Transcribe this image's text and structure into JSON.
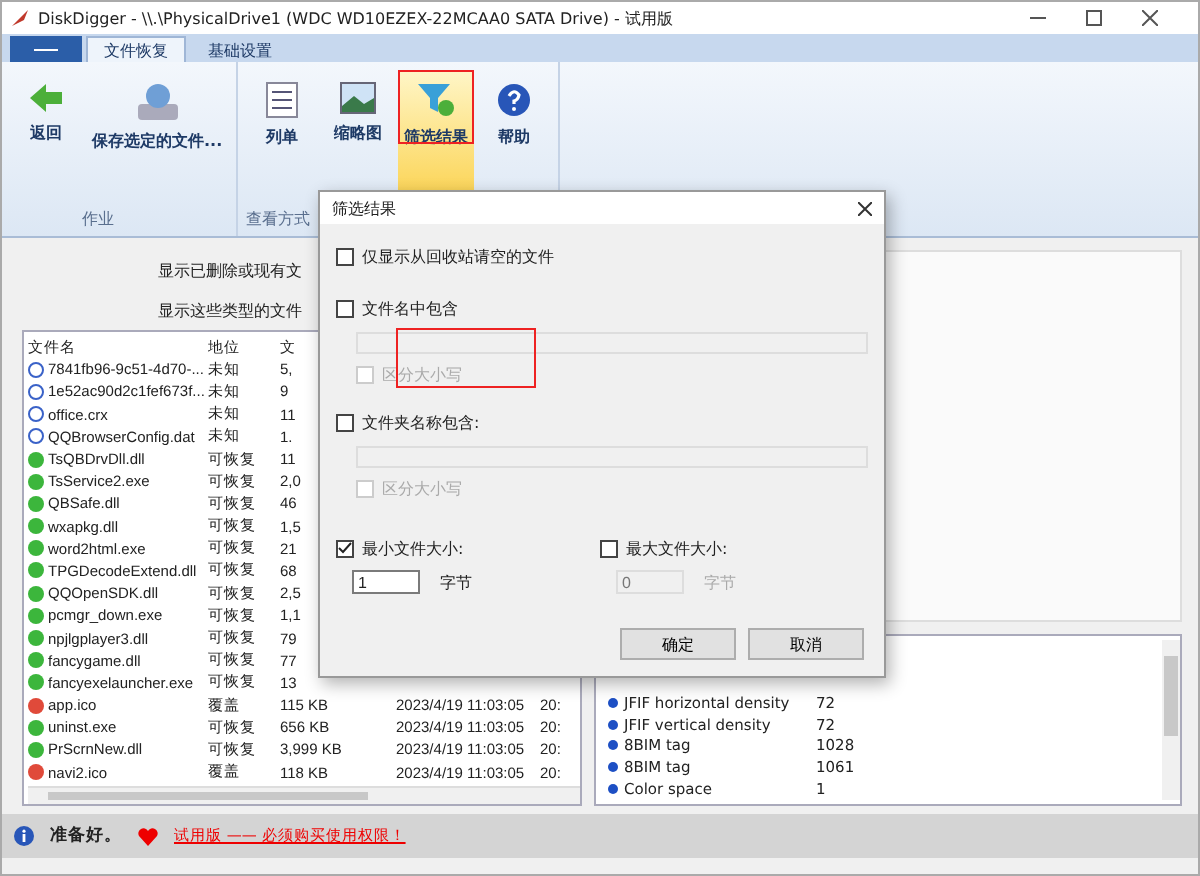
{
  "window": {
    "title": "DiskDigger - \\\\.\\PhysicalDrive1 (WDC WD10EZEX-22MCAA0 SATA Drive) - 试用版"
  },
  "ribbon": {
    "tabs": [
      {
        "label": "文件恢复",
        "selected": true
      },
      {
        "label": "基础设置",
        "selected": false
      }
    ],
    "groups": [
      {
        "label": "作业",
        "buttons": [
          {
            "label": "返回",
            "kind": "back",
            "selected": false
          },
          {
            "label": "保存选定的文件...",
            "kind": "save",
            "selected": false
          }
        ]
      },
      {
        "label": "查看方式",
        "buttons": [
          {
            "label": "列单",
            "kind": "list",
            "selected": false
          },
          {
            "label": "缩略图",
            "kind": "thumbs",
            "selected": false
          },
          {
            "label": "筛选结果",
            "kind": "filter",
            "selected": true
          },
          {
            "label": "帮助",
            "kind": "help",
            "selected": false
          }
        ]
      }
    ]
  },
  "filters": {
    "labels": [
      "显示已删除或现有文",
      "显示这些类型的文件"
    ]
  },
  "file_list": {
    "columns": [
      "文件名",
      "地位",
      "文"
    ],
    "rows": [
      {
        "name": "7841fb96-9c51-4d70-...",
        "status": "未知",
        "kind": "unknown",
        "size": "5,",
        "date": "",
        "col5": ""
      },
      {
        "name": "1e52ac90d2c1fef673f...",
        "status": "未知",
        "kind": "unknown",
        "size": "9",
        "date": "",
        "col5": ""
      },
      {
        "name": "office.crx",
        "status": "未知",
        "kind": "unknown",
        "size": "11",
        "date": "",
        "col5": ""
      },
      {
        "name": "QQBrowserConfig.dat",
        "status": "未知",
        "kind": "unknown",
        "size": "1.",
        "date": "",
        "col5": ""
      },
      {
        "name": "TsQBDrvDll.dll",
        "status": "可恢复",
        "kind": "good",
        "size": "11",
        "date": "",
        "col5": ""
      },
      {
        "name": "TsService2.exe",
        "status": "可恢复",
        "kind": "good",
        "size": "2,0",
        "date": "",
        "col5": ""
      },
      {
        "name": "QBSafe.dll",
        "status": "可恢复",
        "kind": "good",
        "size": "46",
        "date": "",
        "col5": ""
      },
      {
        "name": "wxapkg.dll",
        "status": "可恢复",
        "kind": "good",
        "size": "1,5",
        "date": "",
        "col5": ""
      },
      {
        "name": "word2html.exe",
        "status": "可恢复",
        "kind": "good",
        "size": "21",
        "date": "",
        "col5": ""
      },
      {
        "name": "TPGDecodeExtend.dll",
        "status": "可恢复",
        "kind": "good",
        "size": "68",
        "date": "",
        "col5": ""
      },
      {
        "name": "QQOpenSDK.dll",
        "status": "可恢复",
        "kind": "good",
        "size": "2,5",
        "date": "",
        "col5": ""
      },
      {
        "name": "pcmgr_down.exe",
        "status": "可恢复",
        "kind": "good",
        "size": "1,1",
        "date": "",
        "col5": ""
      },
      {
        "name": "npjlgplayer3.dll",
        "status": "可恢复",
        "kind": "good",
        "size": "79",
        "date": "",
        "col5": ""
      },
      {
        "name": "fancygame.dll",
        "status": "可恢复",
        "kind": "good",
        "size": "77",
        "date": "",
        "col5": ""
      },
      {
        "name": "fancyexelauncher.exe",
        "status": "可恢复",
        "kind": "good",
        "size": "13",
        "date": "",
        "col5": ""
      },
      {
        "name": "app.ico",
        "status": "覆盖",
        "kind": "bad",
        "size": "115 KB",
        "date": "2023/4/19 11:03:05",
        "col5": "20:"
      },
      {
        "name": "uninst.exe",
        "status": "可恢复",
        "kind": "good",
        "size": "656 KB",
        "date": "2023/4/19 11:03:05",
        "col5": "20:"
      },
      {
        "name": "PrScrnNew.dll",
        "status": "可恢复",
        "kind": "good",
        "size": "3,999 KB",
        "date": "2023/4/19 11:03:05",
        "col5": "20:"
      },
      {
        "name": "navi2.ico",
        "status": "覆盖",
        "kind": "bad",
        "size": "118 KB",
        "date": "2023/4/19 11:03:05",
        "col5": "20:"
      }
    ]
  },
  "properties": [
    {
      "name": "JFIF horizontal density",
      "value": "72"
    },
    {
      "name": "JFIF vertical density",
      "value": "72"
    },
    {
      "name": "8BIM tag",
      "value": "1028"
    },
    {
      "name": "8BIM tag",
      "value": "1061"
    },
    {
      "name": "Color space",
      "value": "1"
    }
  ],
  "status_bar": {
    "text": "准备好。",
    "link": "试用版 —— 必须购买使用权限！"
  },
  "dialog": {
    "title": "筛选结果",
    "recycle": {
      "label": "仅显示从回收站请空的文件",
      "checked": false
    },
    "name_filter": {
      "label": "文件名中包含",
      "checked": false,
      "case": {
        "label": "区分大小写",
        "checked": false
      }
    },
    "folder_filter": {
      "label": "文件夹名称包含:",
      "checked": false,
      "case": {
        "label": "区分大小写",
        "checked": false
      }
    },
    "min_size": {
      "label": "最小文件大小:",
      "checked": true,
      "value": "1",
      "unit": "字节"
    },
    "max_size": {
      "label": "最大文件大小:",
      "checked": false,
      "value": "0",
      "unit": "字节"
    },
    "buttons": [
      "确定",
      "取消"
    ]
  }
}
